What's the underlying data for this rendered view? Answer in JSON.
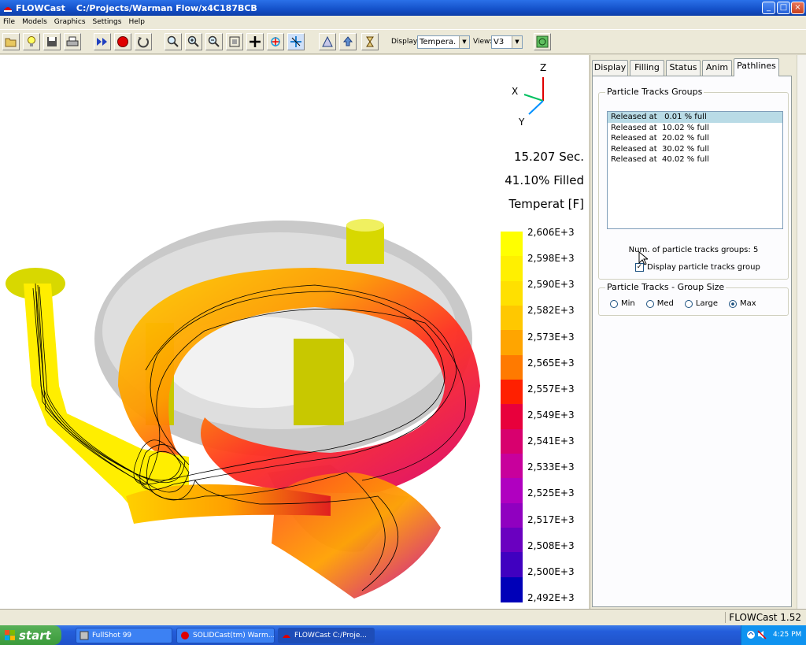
{
  "window": {
    "app_name": "FLOWCast",
    "path": "C:/Projects/Warman Flow/x4C187BCB",
    "min_label": "_",
    "max_label": "□",
    "close_label": "×"
  },
  "menu": [
    "File",
    "Models",
    "Graphics",
    "Settings",
    "Help"
  ],
  "toolbar": {
    "display_label": "Display:",
    "display_value": "Tempera.",
    "view_label": "View:",
    "view_value": "V3"
  },
  "viewport": {
    "axes": {
      "z": "Z",
      "x": "X",
      "y": "Y"
    },
    "time_text": "15.207 Sec.",
    "filled_text": "41.10% Filled",
    "quantity_text": "Temperat [F]",
    "legend": {
      "labels": [
        "2,606E+3",
        "2,598E+3",
        "2,590E+3",
        "2,582E+3",
        "2,573E+3",
        "2,565E+3",
        "2,557E+3",
        "2,549E+3",
        "2,541E+3",
        "2,533E+3",
        "2,525E+3",
        "2,517E+3",
        "2,508E+3",
        "2,500E+3",
        "2,492E+3"
      ],
      "colors": [
        "#ffff00",
        "#fff000",
        "#ffe000",
        "#ffc800",
        "#ffa500",
        "#ff7a00",
        "#ff2000",
        "#e8003c",
        "#d8006e",
        "#c8009c",
        "#b000c0",
        "#9000c0",
        "#6a00c0",
        "#4000c0",
        "#0000b8"
      ]
    }
  },
  "panel": {
    "tabs": [
      "Display",
      "Filling",
      "Status",
      "Anim",
      "Pathlines"
    ],
    "active_tab": "Pathlines",
    "groups_title": "Particle Tracks Groups",
    "groups": [
      "Released at   0.01 % full",
      "Released at  10.02 % full",
      "Released at  20.02 % full",
      "Released at  30.02 % full",
      "Released at  40.02 % full"
    ],
    "num_groups_text": "Num. of particle tracks groups: 5",
    "display_checkbox_label": "Display particle tracks group",
    "display_checked": true,
    "size_title": "Particle Tracks - Group Size",
    "size_options": [
      "Min",
      "Med",
      "Large",
      "Max"
    ],
    "size_selected": "Max"
  },
  "status": {
    "version": "FLOWCast 1.52"
  },
  "taskbar": {
    "start": "start",
    "tasks": [
      "FullShot 99",
      "SOLIDCast(tm) Warm...",
      "FLOWCast   C:/Proje..."
    ],
    "time": "4:25 PM"
  }
}
